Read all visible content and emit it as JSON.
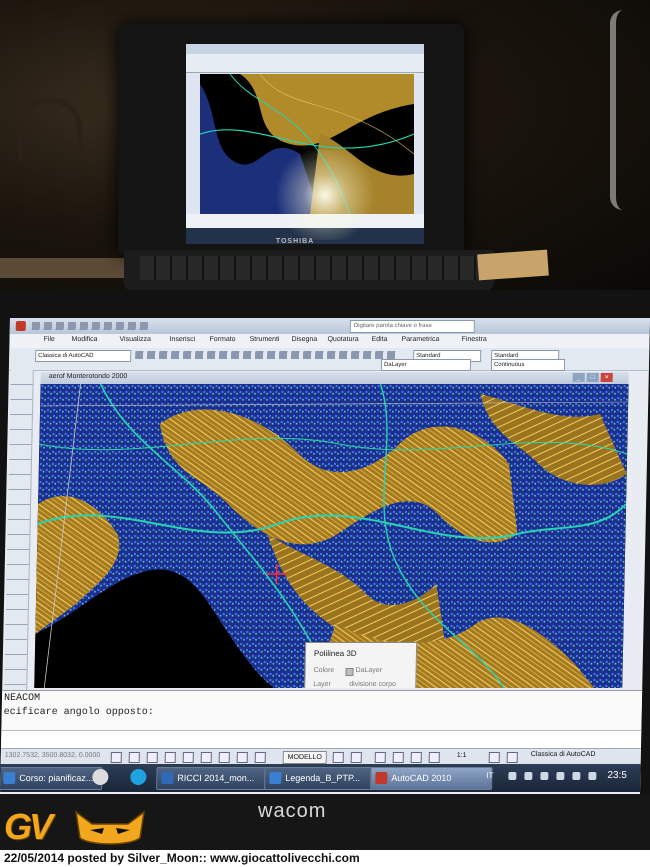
{
  "laptop": {
    "brand": "TOSHIBA"
  },
  "autocad": {
    "search_placeholder": "Digitare parola chiave o frase",
    "menu": [
      "File",
      "Modifica",
      "Visualizza",
      "Inserisci",
      "Formato",
      "Strumenti",
      "Disegna",
      "Quotatura",
      "Edita",
      "Parametrica",
      "Finestra"
    ],
    "workspace_combo": "Classica di AutoCAD",
    "text_style": "Standard",
    "dim_style": "Standard",
    "layer_combo": "DaLayer",
    "linetype_combo": "Continuous",
    "document_title": "aerof Monterotondo 2000",
    "tooltip": {
      "title": "Polilinea 3D",
      "color_label": "Colore",
      "color_value": "DaLayer",
      "layer_label": "Layer",
      "layer_value": "divisione corpo"
    },
    "command_lines": [
      "NEACOM",
      "ecificare angolo opposto:"
    ],
    "status": {
      "coords": "1302.7532, 3500.8032, 0.0000",
      "model": "MODELLO",
      "scale": "1:1",
      "workspace": "Classica di AutoCAD"
    }
  },
  "taskbar": {
    "buttons": [
      {
        "label": "Corso: pianificaz...",
        "color": "#3b7fd1"
      },
      {
        "label": "RICCI 2014_mon...",
        "color": "#2d6bb8"
      },
      {
        "label": "Legenda_B_PTP...",
        "color": "#3b7fd1"
      },
      {
        "label": "AutoCAD 2010",
        "color": "#c0392b"
      }
    ],
    "language": "IT",
    "clock": "23:5"
  },
  "tablet_brand": "wacom",
  "watermark_logo": "GV",
  "caption": "22/05/2014 posted by Silver_Moon:: www.giocattolivecchi.com",
  "colors": {
    "contours": "#d6a93a",
    "roads": "#27d3b2",
    "buildings": "#3359d6"
  }
}
